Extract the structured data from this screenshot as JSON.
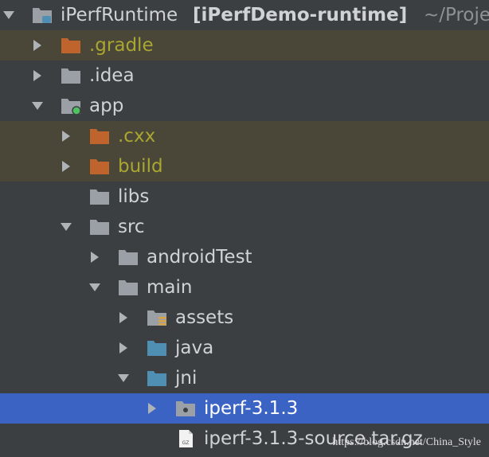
{
  "project": {
    "name": "iPerfRuntime",
    "module": "[iPerfDemo-runtime]",
    "path": "~/Proje"
  },
  "nodes": [
    {
      "label": ".gradle",
      "state": "collapsed",
      "icon": "folder-icon",
      "ignored": true
    },
    {
      "label": ".idea",
      "state": "collapsed",
      "icon": "folder-icon"
    },
    {
      "label": "app",
      "state": "expanded",
      "icon": "module-folder-icon"
    },
    {
      "label": ".cxx",
      "state": "collapsed",
      "icon": "folder-icon",
      "ignored": true
    },
    {
      "label": "build",
      "state": "collapsed",
      "icon": "folder-icon",
      "ignored": true
    },
    {
      "label": "libs",
      "state": "leaf",
      "icon": "folder-icon"
    },
    {
      "label": "src",
      "state": "expanded",
      "icon": "folder-icon"
    },
    {
      "label": "androidTest",
      "state": "collapsed",
      "icon": "folder-icon"
    },
    {
      "label": "main",
      "state": "expanded",
      "icon": "folder-icon"
    },
    {
      "label": "assets",
      "state": "collapsed",
      "icon": "resources-folder-icon"
    },
    {
      "label": "java",
      "state": "collapsed",
      "icon": "source-folder-icon"
    },
    {
      "label": "jni",
      "state": "expanded",
      "icon": "source-folder-icon"
    },
    {
      "label": "iperf-3.1.3",
      "state": "collapsed",
      "icon": "package-folder-icon",
      "selected": true
    },
    {
      "label": "iperf-3.1.3-source.tar.gz",
      "state": "leaf",
      "icon": "gz-archive-icon"
    }
  ],
  "watermark": "https://blog.csdn.net/China_Style",
  "colors": {
    "background": "#3c3f41",
    "ignored_row": "#4a4738",
    "ignored_text": "#a9a632",
    "ignored_folder": "#c0642d",
    "folder": "#9aa0a6",
    "source_folder": "#4f8fb3",
    "module_badge": "#4ec35f",
    "selection": "#3b63c4",
    "text": "#d0d3d6"
  }
}
